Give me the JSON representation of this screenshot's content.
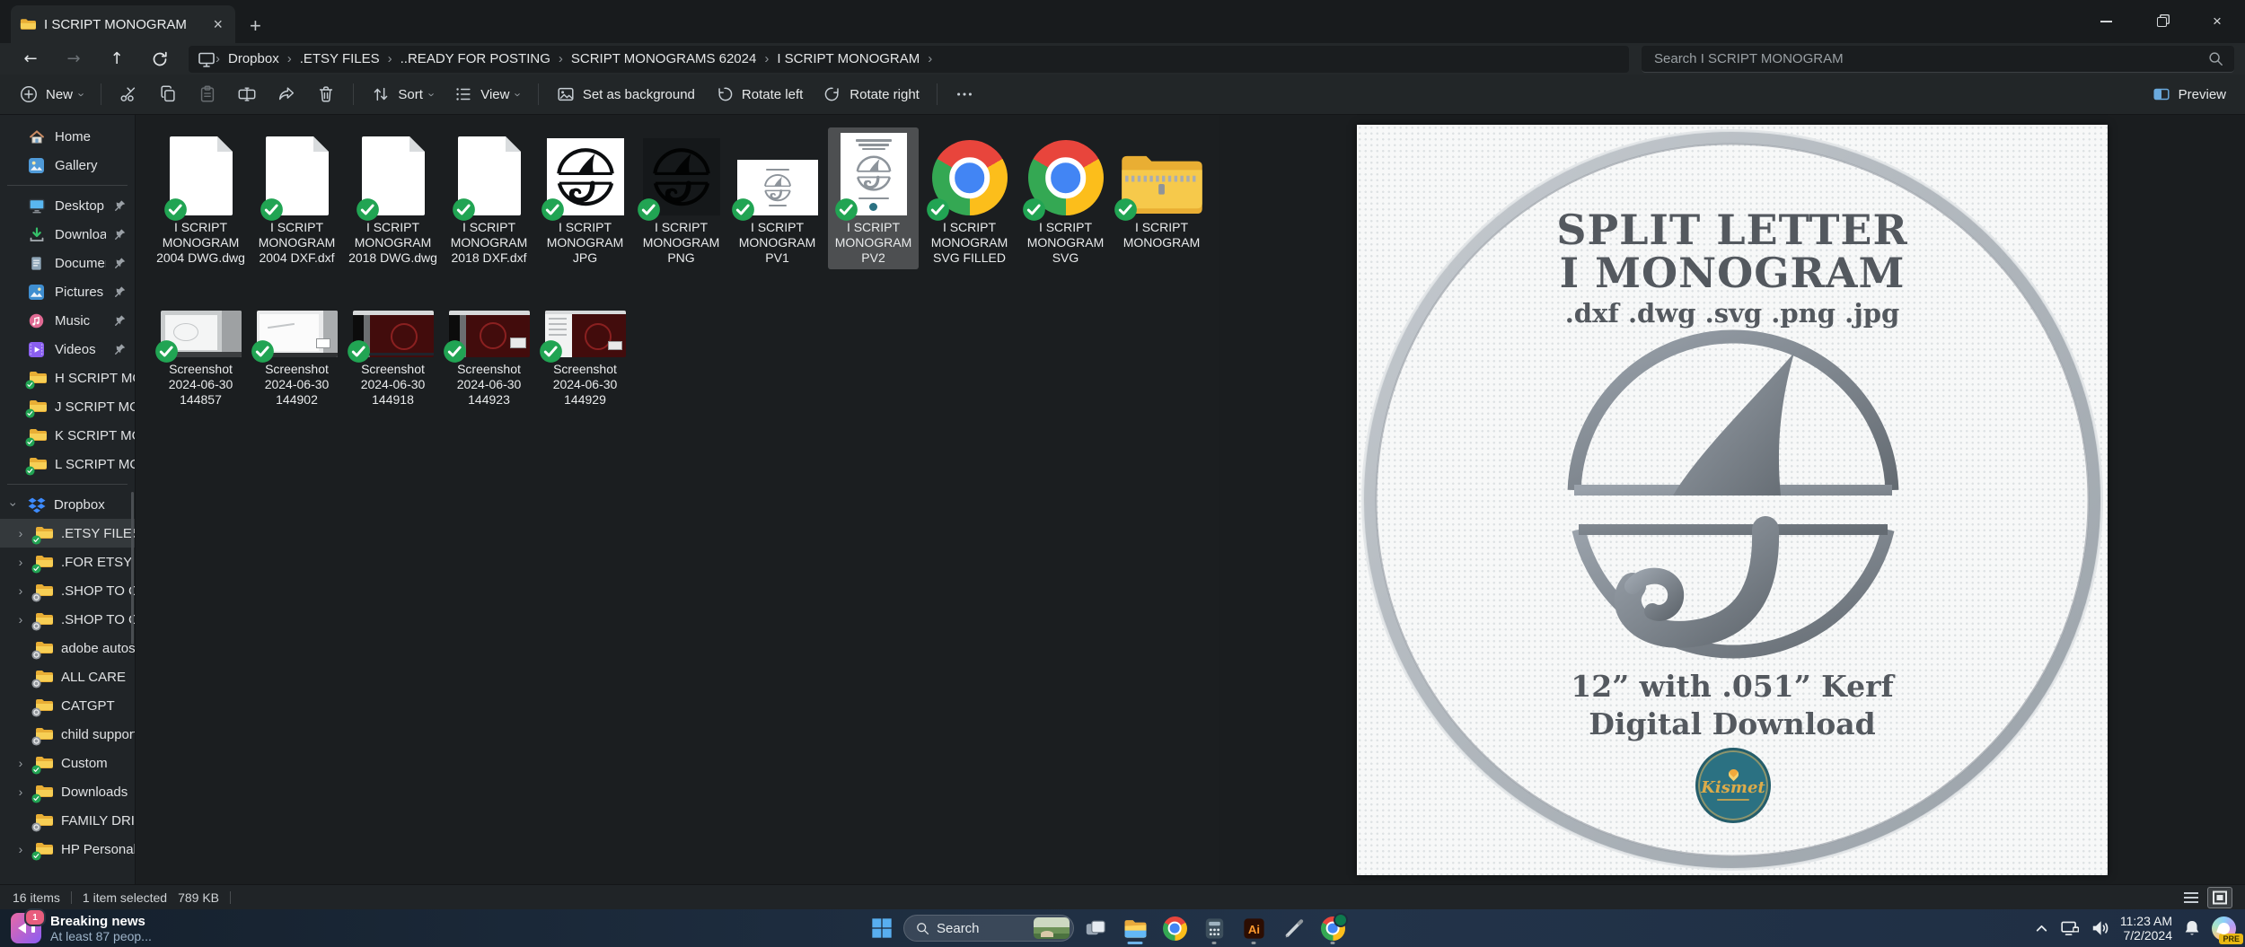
{
  "titlebar": {
    "tab_title": "I SCRIPT MONOGRAM"
  },
  "addressbar": {
    "breadcrumbs": [
      "Dropbox",
      ".ETSY FILES",
      "..READY FOR POSTING",
      "SCRIPT MONOGRAMS 62024",
      "I SCRIPT MONOGRAM"
    ],
    "search_placeholder": "Search I SCRIPT MONOGRAM"
  },
  "toolbar": {
    "new_label": "New",
    "sort_label": "Sort",
    "view_label": "View",
    "set_background_label": "Set as background",
    "rotate_left_label": "Rotate left",
    "rotate_right_label": "Rotate right",
    "preview_label": "Preview"
  },
  "sidebar": {
    "items_top": [
      {
        "label": "Home"
      },
      {
        "label": "Gallery"
      }
    ],
    "items_pinned": [
      {
        "label": "Desktop"
      },
      {
        "label": "Downloads"
      },
      {
        "label": "Documents"
      },
      {
        "label": "Pictures"
      },
      {
        "label": "Music"
      },
      {
        "label": "Videos"
      }
    ],
    "items_folders": [
      {
        "label": "H SCRIPT MONO",
        "sync": "synced"
      },
      {
        "label": "J SCRIPT MONO",
        "sync": "synced"
      },
      {
        "label": "K SCRIPT MONO",
        "sync": "synced"
      },
      {
        "label": "L SCRIPT MONO",
        "sync": "synced"
      }
    ],
    "dropbox_label": "Dropbox",
    "dropbox_children": [
      {
        "label": ".ETSY FILES",
        "sync": "synced",
        "selected": true
      },
      {
        "label": ".FOR ETSY",
        "sync": "synced"
      },
      {
        "label": ".SHOP TO CUT",
        "sync": "pending"
      },
      {
        "label": ".SHOP TO CUT",
        "sync": "pending"
      },
      {
        "label": "adobe autosav",
        "sync": "pending"
      },
      {
        "label": "ALL CARE",
        "sync": "pending"
      },
      {
        "label": "CATGPT",
        "sync": "pending"
      },
      {
        "label": "child support",
        "sync": "pending"
      },
      {
        "label": "Custom",
        "sync": "synced"
      },
      {
        "label": "Downloads",
        "sync": "synced"
      },
      {
        "label": "FAMILY DRIVE",
        "sync": "pending"
      },
      {
        "label": "HP Personal M",
        "sync": "synced"
      }
    ]
  },
  "files": {
    "row1": [
      {
        "name": "I SCRIPT MONOGRAM 2004 DWG.dwg",
        "kind": "dwg document"
      },
      {
        "name": "I SCRIPT MONOGRAM 2004 DXF.dxf",
        "kind": "dxf document"
      },
      {
        "name": "I SCRIPT MONOGRAM 2018 DWG.dwg",
        "kind": "dwg document"
      },
      {
        "name": "I SCRIPT MONOGRAM 2018 DXF.dxf",
        "kind": "dxf document"
      },
      {
        "name": "I SCRIPT MONOGRAM JPG",
        "kind": "jpeg image"
      },
      {
        "name": "I SCRIPT MONOGRAM PNG",
        "kind": "png image"
      },
      {
        "name": "I SCRIPT MONOGRAM PV1",
        "kind": "preview image"
      },
      {
        "name": "I SCRIPT MONOGRAM PV2",
        "kind": "preview image",
        "selected": true
      },
      {
        "name": "I SCRIPT MONOGRAM SVG FILLED",
        "kind": "svg (opens in browser)"
      },
      {
        "name": "I SCRIPT MONOGRAM SVG",
        "kind": "svg (opens in browser)"
      },
      {
        "name": "I SCRIPT MONOGRAM",
        "kind": "zipped folder"
      }
    ],
    "row2": [
      {
        "name": "Screenshot 2024-06-30 144857",
        "kind": "screenshot"
      },
      {
        "name": "Screenshot 2024-06-30 144902",
        "kind": "screenshot"
      },
      {
        "name": "Screenshot 2024-06-30 144918",
        "kind": "screenshot"
      },
      {
        "name": "Screenshot 2024-06-30 144923",
        "kind": "screenshot"
      },
      {
        "name": "Screenshot 2024-06-30 144929",
        "kind": "screenshot"
      }
    ]
  },
  "statusbar": {
    "items_count": "16 items",
    "selection": "1 item selected",
    "selection_size": "789 KB"
  },
  "preview": {
    "title_line1": "SPLIT LETTER",
    "title_line2": "I MONOGRAM",
    "formats": ".dxf .dwg .svg .png .jpg",
    "size_line": "12” with .051” Kerf",
    "download_line": "Digital Download",
    "logo_text": "Kismet"
  },
  "taskbar": {
    "widget_title": "Breaking news",
    "widget_subtitle": "At least 87 peop...",
    "widget_badge": "1",
    "search_label": "Search",
    "clock_time": "11:23 AM",
    "clock_date": "7/2/2024",
    "copilot_badge": "PRE"
  }
}
